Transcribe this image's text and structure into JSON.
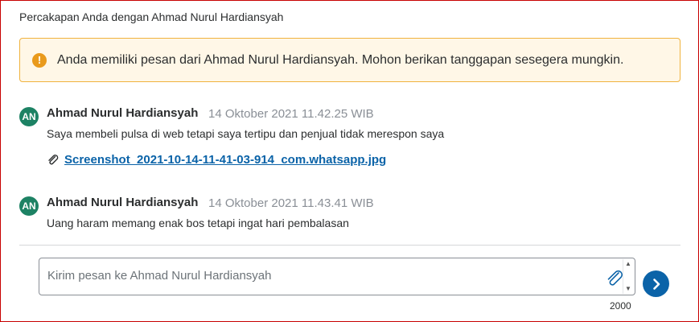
{
  "conversation": {
    "title": "Percakapan Anda dengan Ahmad Nurul Hardiansyah"
  },
  "alert": {
    "icon": "warning-icon",
    "text": "Anda memiliki pesan dari Ahmad Nurul Hardiansyah. Mohon berikan tanggapan sesegera mungkin."
  },
  "messages": [
    {
      "avatar": "AN",
      "sender": "Ahmad Nurul Hardiansyah",
      "time": "14 Oktober 2021 11.42.25 WIB",
      "text": "Saya membeli pulsa di web tetapi saya tertipu dan penjual tidak merespon saya",
      "attachment": "Screenshot_2021-10-14-11-41-03-914_com.whatsapp.jpg"
    },
    {
      "avatar": "AN",
      "sender": "Ahmad Nurul Hardiansyah",
      "time": "14 Oktober 2021 11.43.41 WIB",
      "text": "Uang haram memang enak bos tetapi ingat hari pembalasan"
    }
  ],
  "composer": {
    "placeholder": "Kirim pesan ke Ahmad Nurul Hardiansyah",
    "value": "",
    "char_limit": "2000"
  },
  "colors": {
    "accent": "#0b63a8",
    "avatar_bg": "#1d8264",
    "alert_bg": "#fff7e7",
    "alert_border": "#f0b33f"
  }
}
